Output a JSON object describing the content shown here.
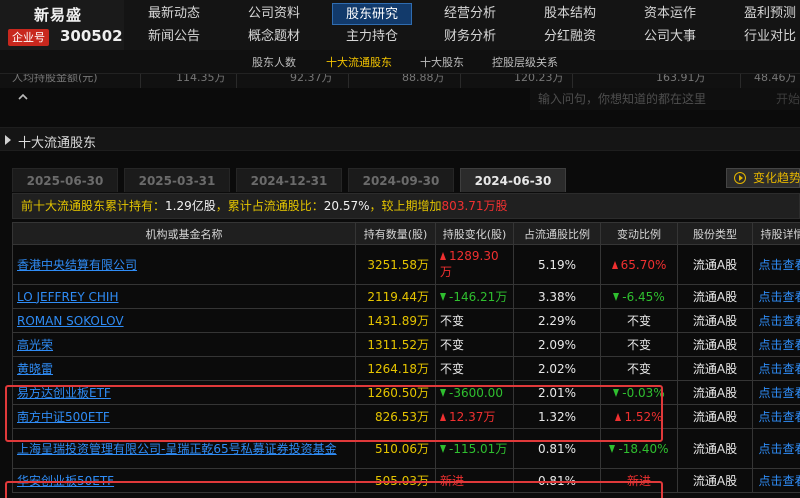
{
  "header": {
    "stock_name": "新易盛",
    "badge": "企业号",
    "stock_code": "300502",
    "nav_row1": [
      "最新动态",
      "公司资料",
      "股东研究",
      "经营分析",
      "股本结构",
      "资本运作",
      "盈利预测"
    ],
    "nav_row2": [
      "新闻公告",
      "概念题材",
      "主力持仓",
      "财务分析",
      "分红融资",
      "公司大事",
      "行业对比"
    ],
    "active_nav": "股东研究"
  },
  "subnav": [
    "股东人数",
    "十大流通股东",
    "十大股东",
    "控股层级关系"
  ],
  "subnav_active": "十大流通股东",
  "strip": {
    "label": "人均持股金额(元)",
    "values": [
      "114.35万",
      "92.37万",
      "88.88万",
      "120.23万",
      "163.91万",
      "48.46万"
    ]
  },
  "ask": {
    "placeholder": "输入问句，你想知道的都在这里",
    "button": "开始搜索"
  },
  "section": {
    "title": "十大流通股东"
  },
  "date_tabs": [
    "2025-06-30",
    "2025-03-31",
    "2024-12-31",
    "2024-09-30",
    "2024-06-30"
  ],
  "active_date": "2024-06-30",
  "trend_button": "变化趋势",
  "summary": {
    "p1": "前十大流通股东累计持有：",
    "hold": "1.29亿股",
    "p2": "，累计占流通股比：",
    "ratio": "20.57%",
    "p3": "，较上期增加",
    "inc": "803.71万股"
  },
  "table": {
    "headers": [
      "机构或基金名称",
      "持有数量(股)",
      "持股变化(股)",
      "占流通股比例",
      "变动比例",
      "股份类型",
      "持股详情"
    ],
    "rows": [
      {
        "name": "香港中央结算有限公司",
        "qty": "3251.58万",
        "chg": "1289.30万",
        "chg_dir": "up",
        "pct": "5.19%",
        "var": "65.70%",
        "var_dir": "up",
        "type": "流通A股",
        "detail": "点击查看"
      },
      {
        "name": "LO JEFFREY CHIH",
        "qty": "2119.44万",
        "chg": "-146.21万",
        "chg_dir": "down",
        "pct": "3.38%",
        "var": "-6.45%",
        "var_dir": "down",
        "type": "流通A股",
        "detail": "点击查看"
      },
      {
        "name": "ROMAN SOKOLOV",
        "qty": "1431.89万",
        "chg": "不变",
        "chg_dir": "none",
        "pct": "2.29%",
        "var": "不变",
        "var_dir": "none",
        "type": "流通A股",
        "detail": "点击查看"
      },
      {
        "name": "高光荣",
        "qty": "1311.52万",
        "chg": "不变",
        "chg_dir": "none",
        "pct": "2.09%",
        "var": "不变",
        "var_dir": "none",
        "type": "流通A股",
        "detail": "点击查看"
      },
      {
        "name": "黄晓雷",
        "qty": "1264.18万",
        "chg": "不变",
        "chg_dir": "none",
        "pct": "2.02%",
        "var": "不变",
        "var_dir": "none",
        "type": "流通A股",
        "detail": "点击查看"
      },
      {
        "name": "易方达创业板ETF",
        "qty": "1260.50万",
        "chg": "-3600.00",
        "chg_dir": "down",
        "pct": "2.01%",
        "var": "-0.03%",
        "var_dir": "down",
        "type": "流通A股",
        "detail": "点击查看"
      },
      {
        "name": "南方中证500ETF",
        "qty": "826.53万",
        "chg": "12.37万",
        "chg_dir": "up",
        "pct": "1.32%",
        "var": "1.52%",
        "var_dir": "up",
        "type": "流通A股",
        "detail": "点击查看"
      },
      {
        "name": "上海呈瑞投资管理有限公司-呈瑞正乾65号私募证券投资基金",
        "qty": "510.06万",
        "chg": "-115.01万",
        "chg_dir": "down",
        "pct": "0.81%",
        "var": "-18.40%",
        "var_dir": "down",
        "type": "流通A股",
        "detail": "点击查看"
      },
      {
        "name": "华安创业板50ETF",
        "qty": "505.03万",
        "chg": "新进",
        "chg_dir": "new",
        "pct": "0.81%",
        "var": "新进",
        "var_dir": "new",
        "type": "流通A股",
        "detail": "点击查看"
      }
    ]
  }
}
